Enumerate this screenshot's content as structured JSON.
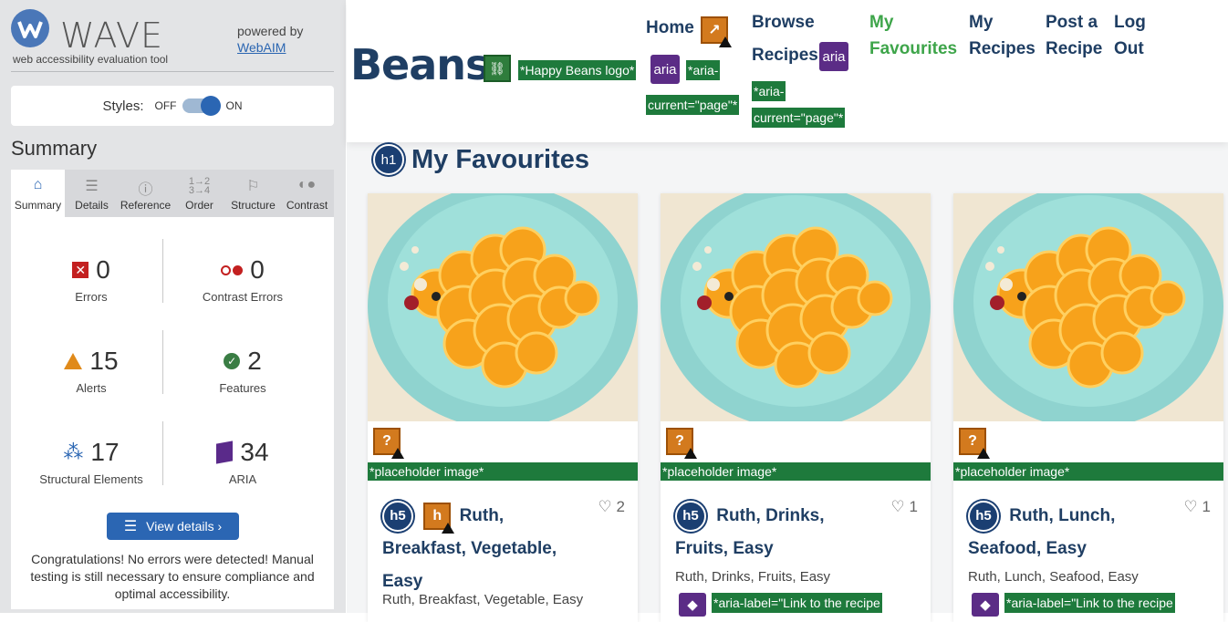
{
  "wave": {
    "logo_text": "WAVE",
    "tagline": "web accessibility evaluation tool",
    "powered_by": "powered by",
    "powered_link": "WebAIM",
    "styles_label": "Styles:",
    "styles_off": "OFF",
    "styles_on": "ON",
    "summary_title": "Summary",
    "tabs": [
      {
        "label": "Summary",
        "icon": "home-icon"
      },
      {
        "label": "Details",
        "icon": "list-icon"
      },
      {
        "label": "Reference",
        "icon": "info-icon"
      },
      {
        "label": "Order",
        "icon": "order-icon"
      },
      {
        "label": "Structure",
        "icon": "structure-icon"
      },
      {
        "label": "Contrast",
        "icon": "contrast-icon"
      }
    ],
    "stats": {
      "errors": {
        "value": "0",
        "label": "Errors"
      },
      "contrast": {
        "value": "0",
        "label": "Contrast Errors"
      },
      "alerts": {
        "value": "15",
        "label": "Alerts"
      },
      "features": {
        "value": "2",
        "label": "Features"
      },
      "structural": {
        "value": "17",
        "label": "Structural Elements"
      },
      "aria": {
        "value": "34",
        "label": "ARIA"
      }
    },
    "view_details": "View details ›",
    "congrats": "Congratulations! No errors were detected! Manual testing is still necessary to ensure compliance and optimal accessibility."
  },
  "site": {
    "brand": "Beans",
    "logo_label": "*Happy Beans logo*",
    "nav": {
      "home": "Home",
      "browse_1": "Browse",
      "browse_2": "Recipes",
      "fav_1": "My",
      "fav_2": "Favourites",
      "myrec_1": "My",
      "myrec_2": "Recipes",
      "post_1": "Post a",
      "post_2": "Recipe",
      "logout_1": "Log",
      "logout_2": "Out"
    },
    "aria_icon": "aria",
    "aria_current_1": "*aria-",
    "aria_current_2": "current=\"page\"*",
    "h1_badge": "h1",
    "page_title": "My Favourites",
    "h5_badge": "h5",
    "placeholder_label": "*placeholder image*",
    "aria_label_text": "*aria-label=\"Link to the recipe",
    "cards": [
      {
        "title_1": "Ruth,",
        "title_2": "Breakfast, Vegetable,",
        "title_3": "Easy",
        "likes": "2",
        "tags": "Ruth, Breakfast, Vegetable, Easy"
      },
      {
        "title_1": "Ruth, Drinks,",
        "title_2": "Fruits, Easy",
        "likes": "1",
        "tags": "Ruth, Drinks, Fruits, Easy"
      },
      {
        "title_1": "Ruth, Lunch,",
        "title_2": "Seafood, Easy",
        "likes": "1",
        "tags": "Ruth, Lunch, Seafood, Easy"
      }
    ]
  }
}
